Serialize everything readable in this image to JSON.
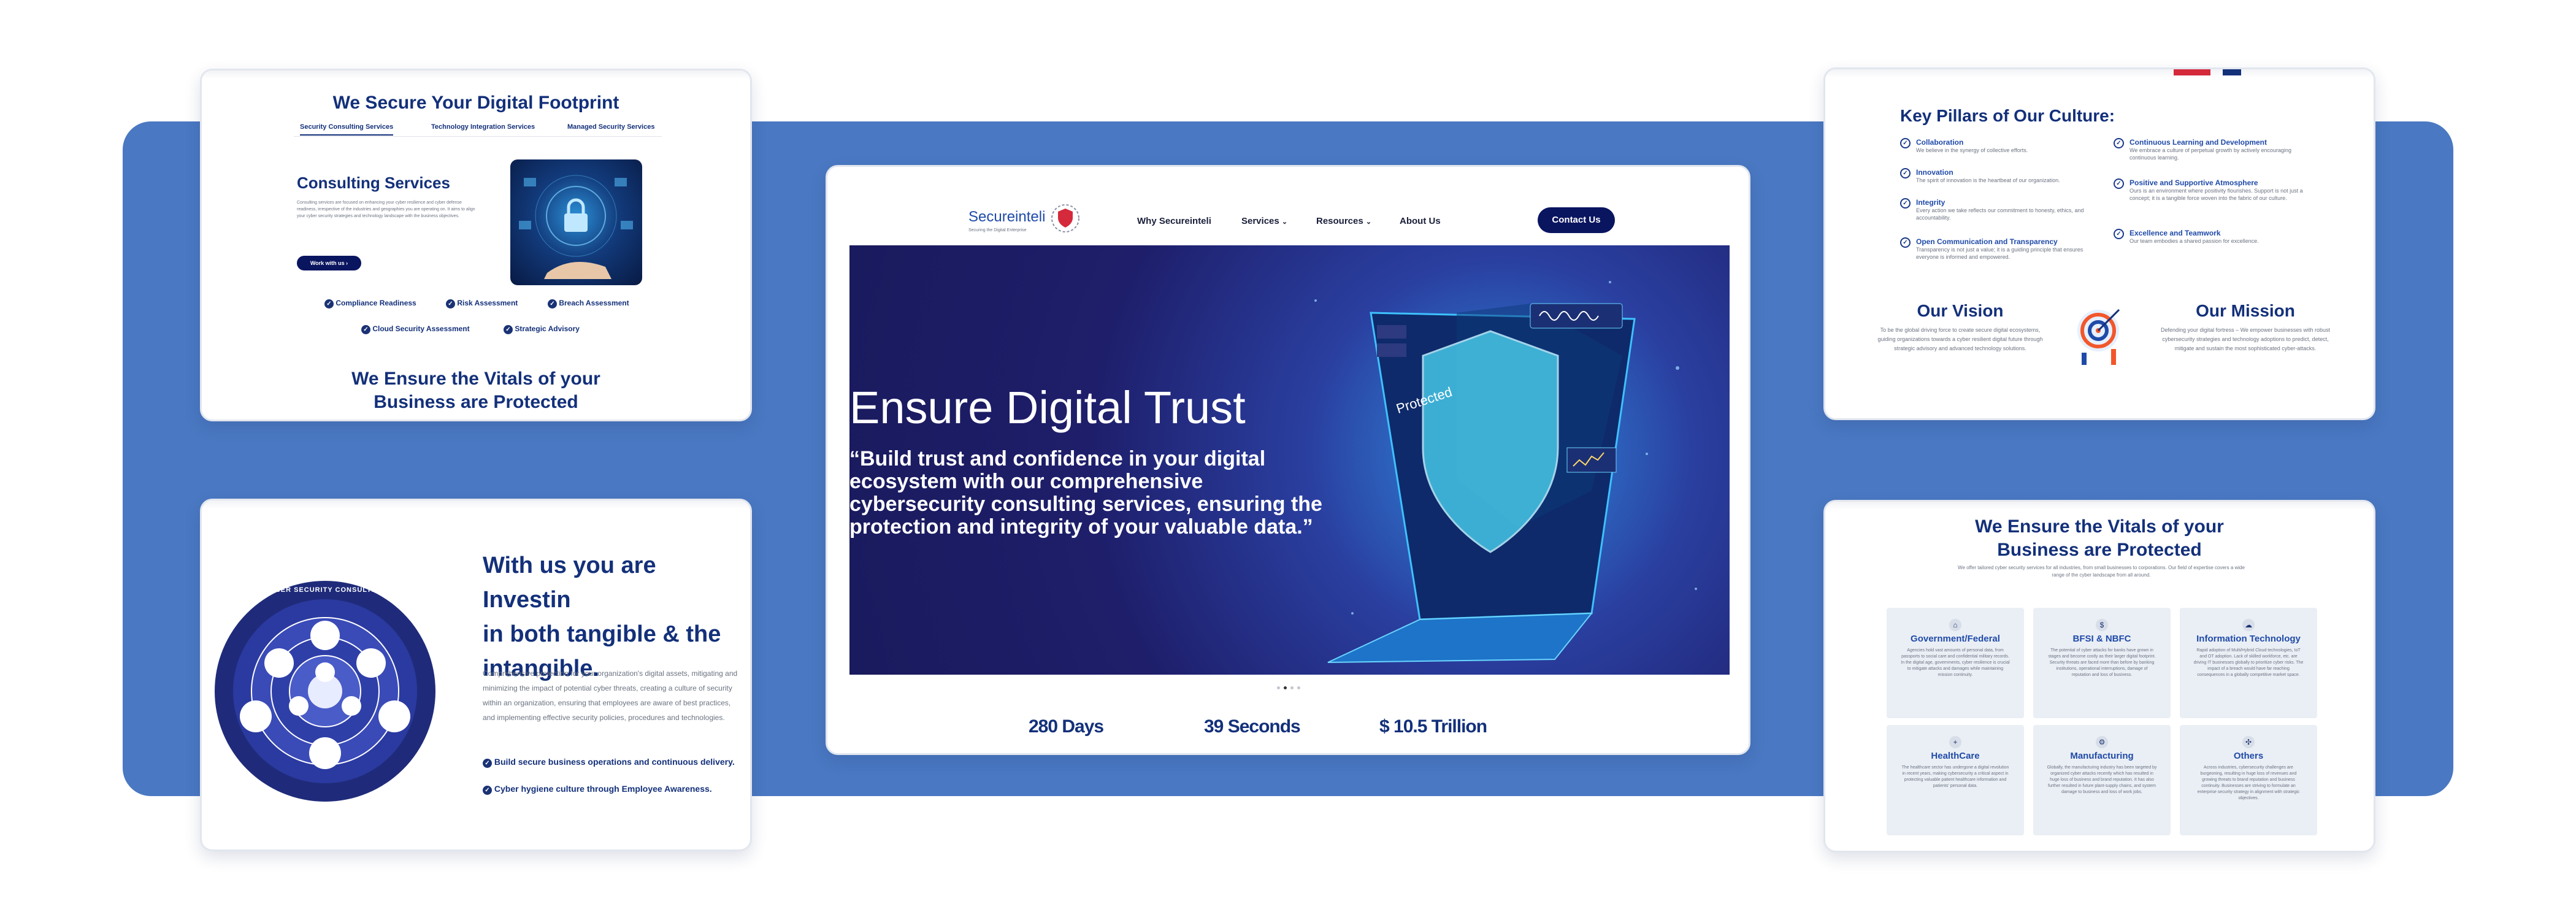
{
  "colors": {
    "band": "#4a78c2",
    "navy": "#13307a",
    "button": "#0a1560",
    "hero_bg": "#1a1a5e"
  },
  "top_left": {
    "title": "We Secure Your Digital Footprint",
    "tabs": [
      "Security Consulting Services",
      "Technology Integration Services",
      "Managed Security Services"
    ],
    "section_title": "Consulting Services",
    "section_text": "Consulting services are focused on enhancing your cyber resilience and cyber defense readiness, irrespective of the industries and geographies you are operating on. It aims to align your cyber security strategies and technology landscape with the business objectives.",
    "button": "Work with us",
    "checks": [
      "Compliance Readiness",
      "Risk Assessment",
      "Breach Assessment",
      "Cloud Security Assessment",
      "Strategic Advisory"
    ],
    "bottom_title_1": "We Ensure the Vitals of your",
    "bottom_title_2": "Business are Protected"
  },
  "bottom_left": {
    "heading_1": "With us you are Investin",
    "heading_2": "in both tangible & the",
    "heading_3": "intangible.",
    "paragraph": "Comprehensive protection for your organization's digital assets, mitigating and minimizing the impact of potential cyber threats, creating a culture of security within an organization, ensuring that employees are aware of best practices, and implementing effective security policies, procedures and technologies.",
    "checks": [
      "Build secure business operations and continuous delivery.",
      "Cyber hygiene culture through Employee Awareness."
    ],
    "wheel_title": "CYBER SECURITY CONSULTING"
  },
  "main": {
    "logo": "Secureinteli",
    "logo_tag": "Securing the Digital Enterprise",
    "nav": [
      "Why Secureinteli",
      "Services",
      "Resources",
      "About Us"
    ],
    "contact": "Contact Us",
    "hero_title": "Ensure Digital Trust",
    "hero_quote": "“Build trust and confidence in your digital ecosystem with our comprehensive cybersecurity consulting services, ensuring the protection and integrity of your valuable data.”",
    "shield_text": "Protected",
    "stats": [
      "280 Days",
      "39 Seconds",
      "$ 10.5 Trillion"
    ]
  },
  "top_right": {
    "title": "Key Pillars of Our Culture:",
    "pillars_left": [
      {
        "t": "Collaboration",
        "d": "We believe in the synergy of collective efforts."
      },
      {
        "t": "Innovation",
        "d": "The spirit of innovation is the heartbeat of our organization."
      },
      {
        "t": "Integrity",
        "d": "Every action we take reflects our commitment to honesty, ethics, and accountability."
      },
      {
        "t": "Open Communication and Transparency",
        "d": "Transparency is not just a value; it is a guiding principle that ensures everyone is informed and empowered."
      }
    ],
    "pillars_right": [
      {
        "t": "Continuous Learning and Development",
        "d": "We embrace a culture of perpetual growth by actively encouraging continuous learning."
      },
      {
        "t": "Positive and Supportive Atmosphere",
        "d": "Ours is an environment where positivity flourishes. Support is not just a concept; it is a tangible force woven into the fabric of our culture."
      },
      {
        "t": "Excellence and Teamwork",
        "d": "Our team embodies a shared passion for excellence."
      }
    ],
    "vision_title": "Our Vision",
    "vision_text": "To be the global driving force to create secure digital ecosystems, guiding organizations towards a cyber resilient digital future through strategic advisory and advanced technology solutions.",
    "mission_title": "Our Mission",
    "mission_text": "Defending your digital fortress – We empower businesses with robust cybersecurity strategies and technology adoptions to predict, detect, mitigate and sustain the most sophisticated cyber-attacks."
  },
  "bottom_right": {
    "title_1": "We Ensure the Vitals of your",
    "title_2": "Business are Protected",
    "subtitle": "We offer tailored cyber security services for all industries, from small businesses to corporations. Our field of expertise covers a wide range of the cyber landscape from all around.",
    "tiles": [
      {
        "t": "Government/Federal",
        "d": "Agencies hold vast amounts of personal data, from passports to social care and confidential military records. In the digital age, governments, cyber resilience is crucial to mitigate attacks and damages while maintaining mission continuity."
      },
      {
        "t": "BFSI & NBFC",
        "d": "The potential of cyber attacks for banks have grown in stages and become costly as their larger digital footprint. Security threats are faced more than before by banking institutions, operational interruptions, damage of reputation and loss of business."
      },
      {
        "t": "Information Technology",
        "d": "Rapid adoption of Multi/Hybrid Cloud technologies, IoT and OT adoption. Lack of skilled workforce, etc. are driving IT businesses globally to prioritize cyber risks. The impact of a breach would have far reaching consequences in a globally competitive market space."
      },
      {
        "t": "HealthCare",
        "d": "The healthcare sector has undergone a digital revolution in recent years, making cybersecurity a critical aspect in protecting valuable patient healthcare information and patients' personal data."
      },
      {
        "t": "Manufacturing",
        "d": "Globally, the manufacturing industry has been targeted by organized cyber attacks recently which has resulted in huge loss of business and brand reputation. It has also further resulted in future plant-supply chains, and system damage to business and loss of work jobs."
      },
      {
        "t": "Others",
        "d": "Across industries, cybersecurity challenges are burgeoning, resulting in huge loss of revenues and growing threats to brand reputation and business continuity. Businesses are striving to formulate an enterprise security strategy in alignment with strategic objectives."
      }
    ]
  }
}
